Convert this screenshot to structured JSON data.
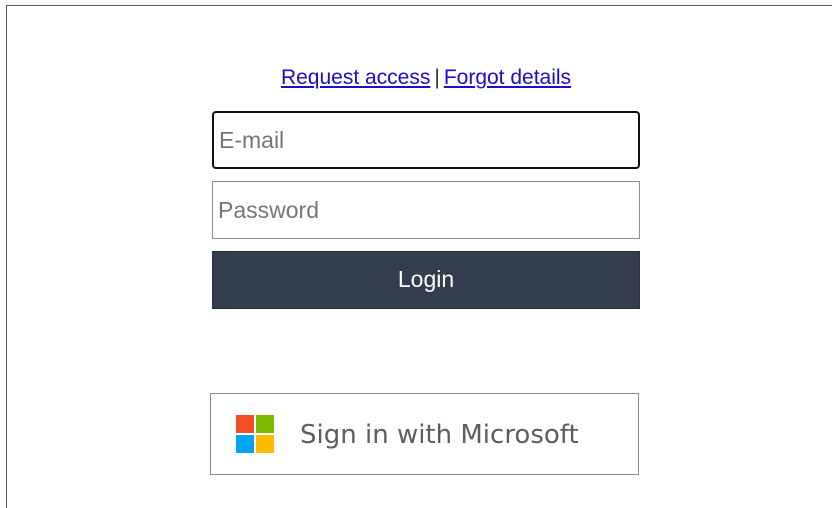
{
  "links": {
    "request_access": "Request access",
    "separator": "|",
    "forgot_details": "Forgot details"
  },
  "form": {
    "email": {
      "value": "",
      "placeholder": "E-mail"
    },
    "password": {
      "value": "",
      "placeholder": "Password"
    },
    "login_label": "Login"
  },
  "microsoft": {
    "label": "Sign in with Microsoft",
    "icon": "microsoft-logo-icon",
    "colors": {
      "red": "#f25022",
      "green": "#7fba00",
      "blue": "#00a4ef",
      "yellow": "#ffb900"
    }
  },
  "colors": {
    "login_button": "#343d4e",
    "link": "#1a0dcc"
  }
}
